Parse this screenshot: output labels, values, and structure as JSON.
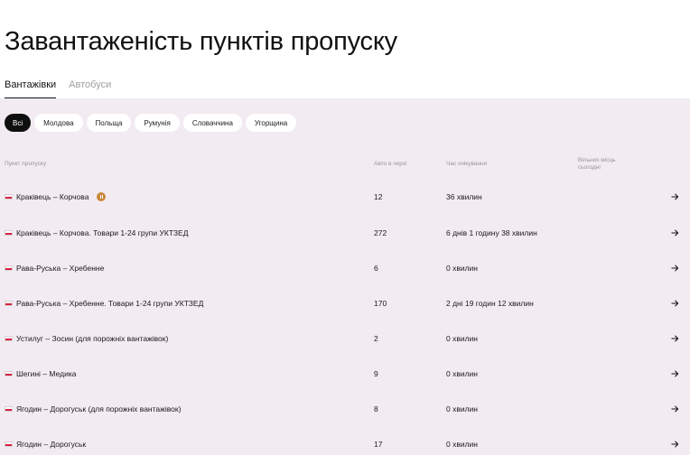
{
  "page": {
    "title": "Завантаженість пунктів пропуску"
  },
  "tabs": [
    {
      "label": "Вантажівки",
      "active": true
    },
    {
      "label": "Автобуси",
      "active": false
    }
  ],
  "filters": [
    {
      "label": "Всі",
      "active": true
    },
    {
      "label": "Молдова",
      "active": false
    },
    {
      "label": "Польща",
      "active": false
    },
    {
      "label": "Румунія",
      "active": false
    },
    {
      "label": "Словаччина",
      "active": false
    },
    {
      "label": "Угорщина",
      "active": false
    }
  ],
  "table": {
    "headers": {
      "name": "Пункт пропуску",
      "queue": "Авто в черзі",
      "wait": "Час очікування",
      "free": "Вільних місць сьогодні"
    },
    "rows": [
      {
        "flag": "poland-flag-icon",
        "name": "Краківець – Корчова",
        "paused": true,
        "queue": "12",
        "wait": "36 хвилин"
      },
      {
        "flag": "poland-flag-icon",
        "name": "Краківець – Корчова. Товари 1-24 групи УКТЗЕД",
        "paused": false,
        "queue": "272",
        "wait": "6 днів 1 годину 38 хвилин"
      },
      {
        "flag": "poland-flag-icon",
        "name": "Рава-Руська – Хребенне",
        "paused": false,
        "queue": "6",
        "wait": "0 хвилин"
      },
      {
        "flag": "poland-flag-icon",
        "name": "Рава-Руська – Хребенне. Товари 1-24 групи УКТЗЕД",
        "paused": false,
        "queue": "170",
        "wait": "2 дні 19 годин 12 хвилин"
      },
      {
        "flag": "poland-flag-icon",
        "name": "Устилуг – Зосин (для порожніх вантажівок)",
        "paused": false,
        "queue": "2",
        "wait": "0 хвилин"
      },
      {
        "flag": "poland-flag-icon",
        "name": "Шегині – Медика",
        "paused": false,
        "queue": "9",
        "wait": "0 хвилин"
      },
      {
        "flag": "poland-flag-icon",
        "name": "Ягодин – Дорогуськ (для порожніх вантажівок)",
        "paused": false,
        "queue": "8",
        "wait": "0 хвилин"
      },
      {
        "flag": "poland-flag-icon",
        "name": "Ягодин – Дорогуськ",
        "paused": false,
        "queue": "17",
        "wait": "0 хвилин"
      }
    ]
  },
  "icons": {
    "pause": "pause-icon",
    "row_action": "arrow-right-icon"
  },
  "colors": {
    "panel_bg": "#f2ebf1",
    "active_chip": "#0f0f0f",
    "pause_badge": "#c8893c"
  }
}
